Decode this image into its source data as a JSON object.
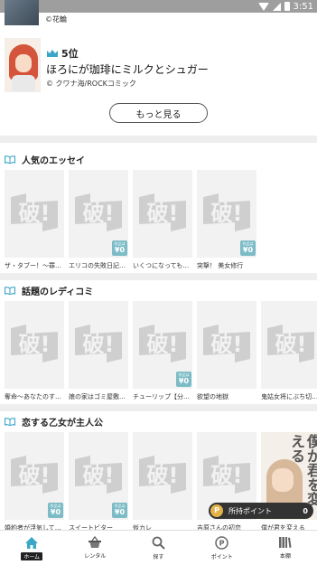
{
  "status_bar": {
    "time": "3:51"
  },
  "prev_ranking": {
    "author": "©花輪"
  },
  "ranking_item": {
    "rank": "5位",
    "title": "ほろにが珈琲にミルクとシュガー",
    "author": "© クワナ海/ROCKコミック"
  },
  "more_button": {
    "label": "もっと見る"
  },
  "sections": [
    {
      "title": "人気のエッセイ",
      "books": [
        {
          "title": "ザ・タブー！～罪…",
          "badge": false
        },
        {
          "title": "エリコの失敗日記…",
          "badge": true
        },
        {
          "title": "いくつになっても…",
          "badge": false
        },
        {
          "title": "突撃！ 美女修行",
          "badge": true
        }
      ]
    },
    {
      "title": "話題のレディコミ",
      "books": [
        {
          "title": "奪命～あなたのす…",
          "badge": false
        },
        {
          "title": "娘の家はゴミ屋敷…",
          "badge": false
        },
        {
          "title": "チューリップ【分…",
          "badge": true
        },
        {
          "title": "欲望の地獄",
          "badge": false
        },
        {
          "title": "鬼姑女将にぶち切…",
          "badge": false
        }
      ]
    },
    {
      "title": "恋する乙女が主人公",
      "books": [
        {
          "title": "婚約者が浮気して…",
          "badge": true
        },
        {
          "title": "スイートビター",
          "badge": true
        },
        {
          "title": "仮カレ",
          "badge": false
        },
        {
          "title": "吉原さんの初恋",
          "badge": false
        },
        {
          "title": "僕が君を変える",
          "badge": false,
          "cover_text": "僕が君を変える"
        }
      ]
    }
  ],
  "badge": {
    "top": "作品は",
    "price": "¥0"
  },
  "points": {
    "label": "所持ポイント",
    "value": "0",
    "icon": "P"
  },
  "tabs": [
    {
      "label": "ホーム",
      "icon": "home-icon",
      "active": true
    },
    {
      "label": "レンタル",
      "icon": "basket-icon",
      "active": false
    },
    {
      "label": "探す",
      "icon": "search-icon",
      "active": false
    },
    {
      "label": "ポイント",
      "icon": "point-icon",
      "active": false
    },
    {
      "label": "本棚",
      "icon": "bookshelf-icon",
      "active": false
    }
  ],
  "colors": {
    "accent": "#3aa6c8",
    "badge": "#7dbcc7",
    "crown": "#3aa6c8"
  }
}
